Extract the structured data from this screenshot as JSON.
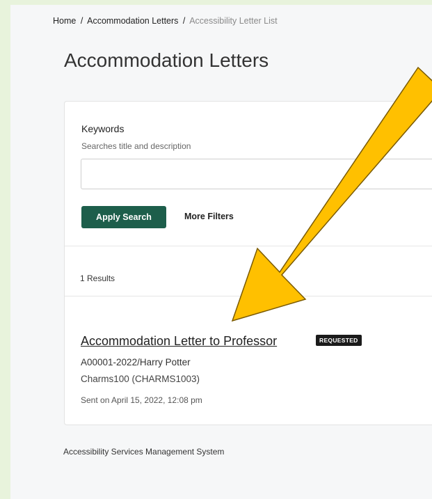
{
  "breadcrumb": {
    "home": "Home",
    "separator": "/",
    "letters": "Accommodation Letters",
    "current": "Accessibility Letter List"
  },
  "page": {
    "title": "Accommodation Letters"
  },
  "filters": {
    "keywords_label": "Keywords",
    "keywords_help": "Searches title and description",
    "keywords_value": "",
    "apply_label": "Apply Search",
    "more_label": "More Filters"
  },
  "results": {
    "count_text": "1 Results",
    "items": [
      {
        "title": "Accommodation Letter to Professor",
        "status": "REQUESTED",
        "case_id": "A00001-2022/Harry Potter",
        "course": "Charms100 (CHARMS1003)",
        "sent_on": "Sent on April 15, 2022, 12:08 pm"
      }
    ]
  },
  "footer": {
    "text": "Accessibility Services Management System"
  },
  "colors": {
    "background": "#e8f3dc",
    "primary_button": "#1d5e4b",
    "badge": "#1b1b1b",
    "annotation_arrow": "#ffc000"
  },
  "icons": {
    "annotation": "pointing-arrow-icon"
  }
}
